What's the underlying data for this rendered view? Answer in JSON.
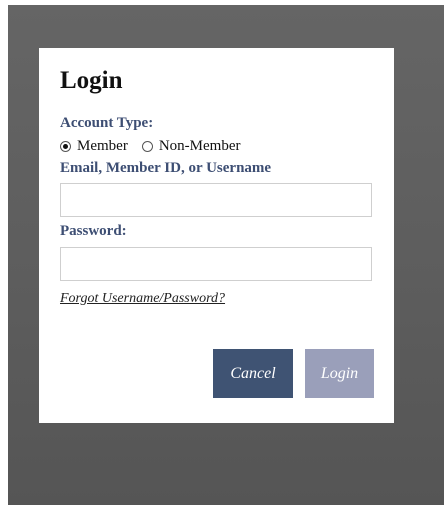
{
  "dialog": {
    "title": "Login",
    "account_type": {
      "label": "Account Type:",
      "options": [
        {
          "label": "Member",
          "selected": true
        },
        {
          "label": "Non-Member",
          "selected": false
        }
      ]
    },
    "email": {
      "label": "Email, Member ID, or Username",
      "value": "",
      "placeholder": ""
    },
    "password": {
      "label": "Password:",
      "value": "",
      "placeholder": ""
    },
    "forgot_link": "Forgot Username/Password?",
    "buttons": {
      "cancel": "Cancel",
      "login": "Login"
    }
  },
  "colors": {
    "overlay": "#5f5f5f",
    "label_text": "#3d4e73",
    "cancel_button": "#3f5373",
    "login_button": "#9a9fba"
  },
  "icons": {
    "radio_selected": "radio-selected-icon",
    "radio_unselected": "radio-unselected-icon"
  }
}
